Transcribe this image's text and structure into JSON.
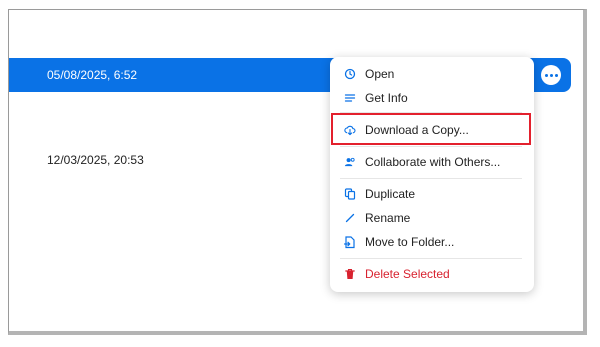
{
  "rows": [
    {
      "date": "05/08/2025, 6:52",
      "selected": true
    },
    {
      "date": "12/03/2025, 20:53",
      "selected": false
    }
  ],
  "more_button_icon": "ellipsis-icon",
  "menu": {
    "items": [
      {
        "label": "Open",
        "icon": "clock-icon"
      },
      {
        "label": "Get Info",
        "icon": "lines-icon"
      },
      {
        "label": "Download a Copy...",
        "icon": "cloud-download-icon",
        "highlighted": true
      },
      {
        "label": "Collaborate with Others...",
        "icon": "people-icon"
      },
      {
        "label": "Duplicate",
        "icon": "duplicate-icon"
      },
      {
        "label": "Rename",
        "icon": "pencil-icon"
      },
      {
        "label": "Move to Folder...",
        "icon": "folder-move-icon"
      },
      {
        "label": "Delete Selected",
        "icon": "trash-icon",
        "danger": true
      }
    ]
  },
  "colors": {
    "accent": "#0a72e6",
    "danger": "#d8222f",
    "highlight_border": "#e3202d"
  }
}
